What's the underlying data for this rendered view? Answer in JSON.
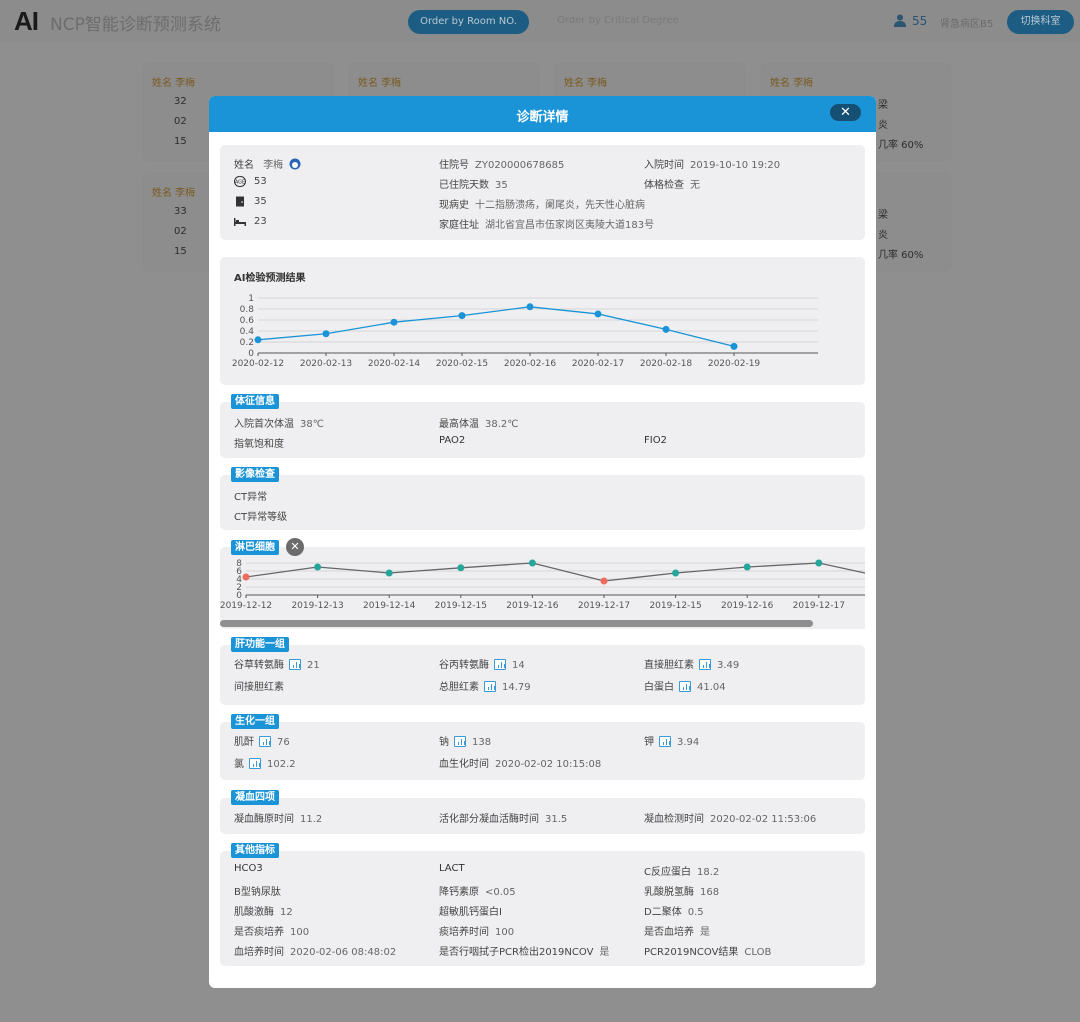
{
  "header": {
    "logo": "AI",
    "title": "NCP智能诊断预测系统",
    "order_room_label": "Order by Room NO.",
    "order_critical_label": "Order by Critical Degree",
    "user_count": "55",
    "ward": "肾急病区B5",
    "switch_label": "切换科室"
  },
  "background_cards": [
    {
      "name": "姓名 李梅",
      "r1": "32",
      "r2": "02",
      "r3": "15"
    },
    {
      "name": "姓名 李梅",
      "r1": "",
      "r2": "",
      "r3": ""
    },
    {
      "name": "姓名 李梅",
      "r1": "",
      "r2": "",
      "r3": ""
    },
    {
      "name": "姓名 李梅",
      "r1": "",
      "r2": "",
      "r3": "",
      "e1": "梁",
      "e2": "炎",
      "e3": "几率 60%"
    },
    {
      "name": "姓名 李梅",
      "r1": "33",
      "r2": "02",
      "r3": "15"
    },
    {
      "name": "",
      "r1": "",
      "r2": "",
      "r3": "",
      "e1": "梁",
      "e2": "炎",
      "e3": "几率 60%"
    }
  ],
  "modal": {
    "title": "诊断详情",
    "close": "✕",
    "patient": {
      "name_label": "姓名",
      "name": "李梅",
      "age": "53",
      "room": "35",
      "bed": "23",
      "hospital_no_label": "住院号",
      "hospital_no": "ZY020000678685",
      "admit_time_label": "入院时间",
      "admit_time": "2019-10-10 19:20",
      "days_label": "已住院天数",
      "days": "35",
      "exam_label": "体格检查",
      "exam": "无",
      "history_label": "现病史",
      "history": "十二指肠溃疡，阑尾炎，先天性心脏病",
      "address_label": "家庭住址",
      "address": "湖北省宜昌市伍家岗区夷陵大道183号"
    },
    "ai_section": {
      "title": "AI检验预测结果"
    },
    "vitals": {
      "badge": "体征信息",
      "first_temp_label": "入院首次体温",
      "first_temp": "38℃",
      "max_temp_label": "最高体温",
      "max_temp": "38.2℃",
      "spo2_label": "指氧饱和度",
      "pao2_label": "PAO2",
      "fio2_label": "FIO2"
    },
    "imaging": {
      "badge": "影像检查",
      "ct_label": "CT异常",
      "ct_level_label": "CT异常等级"
    },
    "lymph": {
      "badge": "淋巴细胞",
      "close": "✕"
    },
    "liver": {
      "badge": "肝功能一组",
      "ast_label": "谷草转氨酶",
      "ast": "21",
      "alt_label": "谷丙转氨酶",
      "alt": "14",
      "dbil_label": "直接胆红素",
      "dbil": "3.49",
      "ibil_label": "间接胆红素",
      "tbil_label": "总胆红素",
      "tbil": "14.79",
      "alb_label": "白蛋白",
      "alb": "41.04"
    },
    "biochem": {
      "badge": "生化一组",
      "crea_label": "肌酐",
      "crea": "76",
      "na_label": "钠",
      "na": "138",
      "k_label": "钾",
      "k": "3.94",
      "cl_label": "氯",
      "cl": "102.2",
      "time_label": "血生化时间",
      "time": "2020-02-02 10:15:08"
    },
    "coag": {
      "badge": "凝血四项",
      "pt_label": "凝血酶原时间",
      "pt": "11.2",
      "aptt_label": "活化部分凝血活酶时间",
      "aptt": "31.5",
      "time_label": "凝血检测时间",
      "time": "2020-02-02 11:53:06"
    },
    "other": {
      "badge": "其他指标",
      "hco3_label": "HCO3",
      "lact_label": "LACT",
      "crp_label": "C反应蛋白",
      "crp": "18.2",
      "bnp_label": "B型钠尿肽",
      "pct_label": "降钙素原",
      "pct": "<0.05",
      "ldh_label": "乳酸脱氢酶",
      "ldh": "168",
      "ck_label": "肌酸激酶",
      "ck": "12",
      "tni_label": "超敏肌钙蛋白I",
      "ddimer_label": "D二聚体",
      "ddimer": "0.5",
      "sputum_label": "是否痰培养",
      "sputum": "100",
      "sputum_time_label": "痰培养时间",
      "sputum_time": "100",
      "blood_cult_label": "是否血培养",
      "blood_cult": "是",
      "blood_time_label": "血培养时间",
      "blood_time": "2020-02-06 08:48:02",
      "pcr_label": "是否行咽拭子PCR检出2019NCOV",
      "pcr": "是",
      "pcr_result_label": "PCR2019NCOV结果",
      "pcr_result": "CLOB"
    }
  },
  "chart_data": [
    {
      "type": "line",
      "title": "AI检验预测结果",
      "categories": [
        "2020-02-12",
        "2020-02-13",
        "2020-02-14",
        "2020-02-15",
        "2020-02-16",
        "2020-02-17",
        "2020-02-18",
        "2020-02-19"
      ],
      "values": [
        0.24,
        0.35,
        0.56,
        0.68,
        0.84,
        0.71,
        0.43,
        0.12
      ],
      "y_ticks": [
        "0",
        "0.2",
        "0.4",
        "0.6",
        "0.8",
        "1"
      ],
      "ylim": [
        0,
        1
      ],
      "color": "#1a94d7",
      "grid": true
    },
    {
      "type": "line",
      "title": "淋巴细胞",
      "categories": [
        "2019-12-12",
        "2019-12-13",
        "2019-12-14",
        "2019-12-15",
        "2019-12-16",
        "2019-12-17",
        "2019-12-15",
        "2019-12-16",
        "2019-12-17"
      ],
      "values": [
        4.5,
        7,
        5.5,
        6.8,
        8,
        3.5,
        5.5,
        7,
        8
      ],
      "y_ticks": [
        "0",
        "2",
        "4",
        "6",
        "8"
      ],
      "ylim": [
        0,
        9
      ],
      "line_color": "#666666",
      "normal_color": "#26a69a",
      "abnormal_color": "#ef6b60",
      "abnormal_points": [
        0,
        5
      ],
      "grid": true
    }
  ]
}
